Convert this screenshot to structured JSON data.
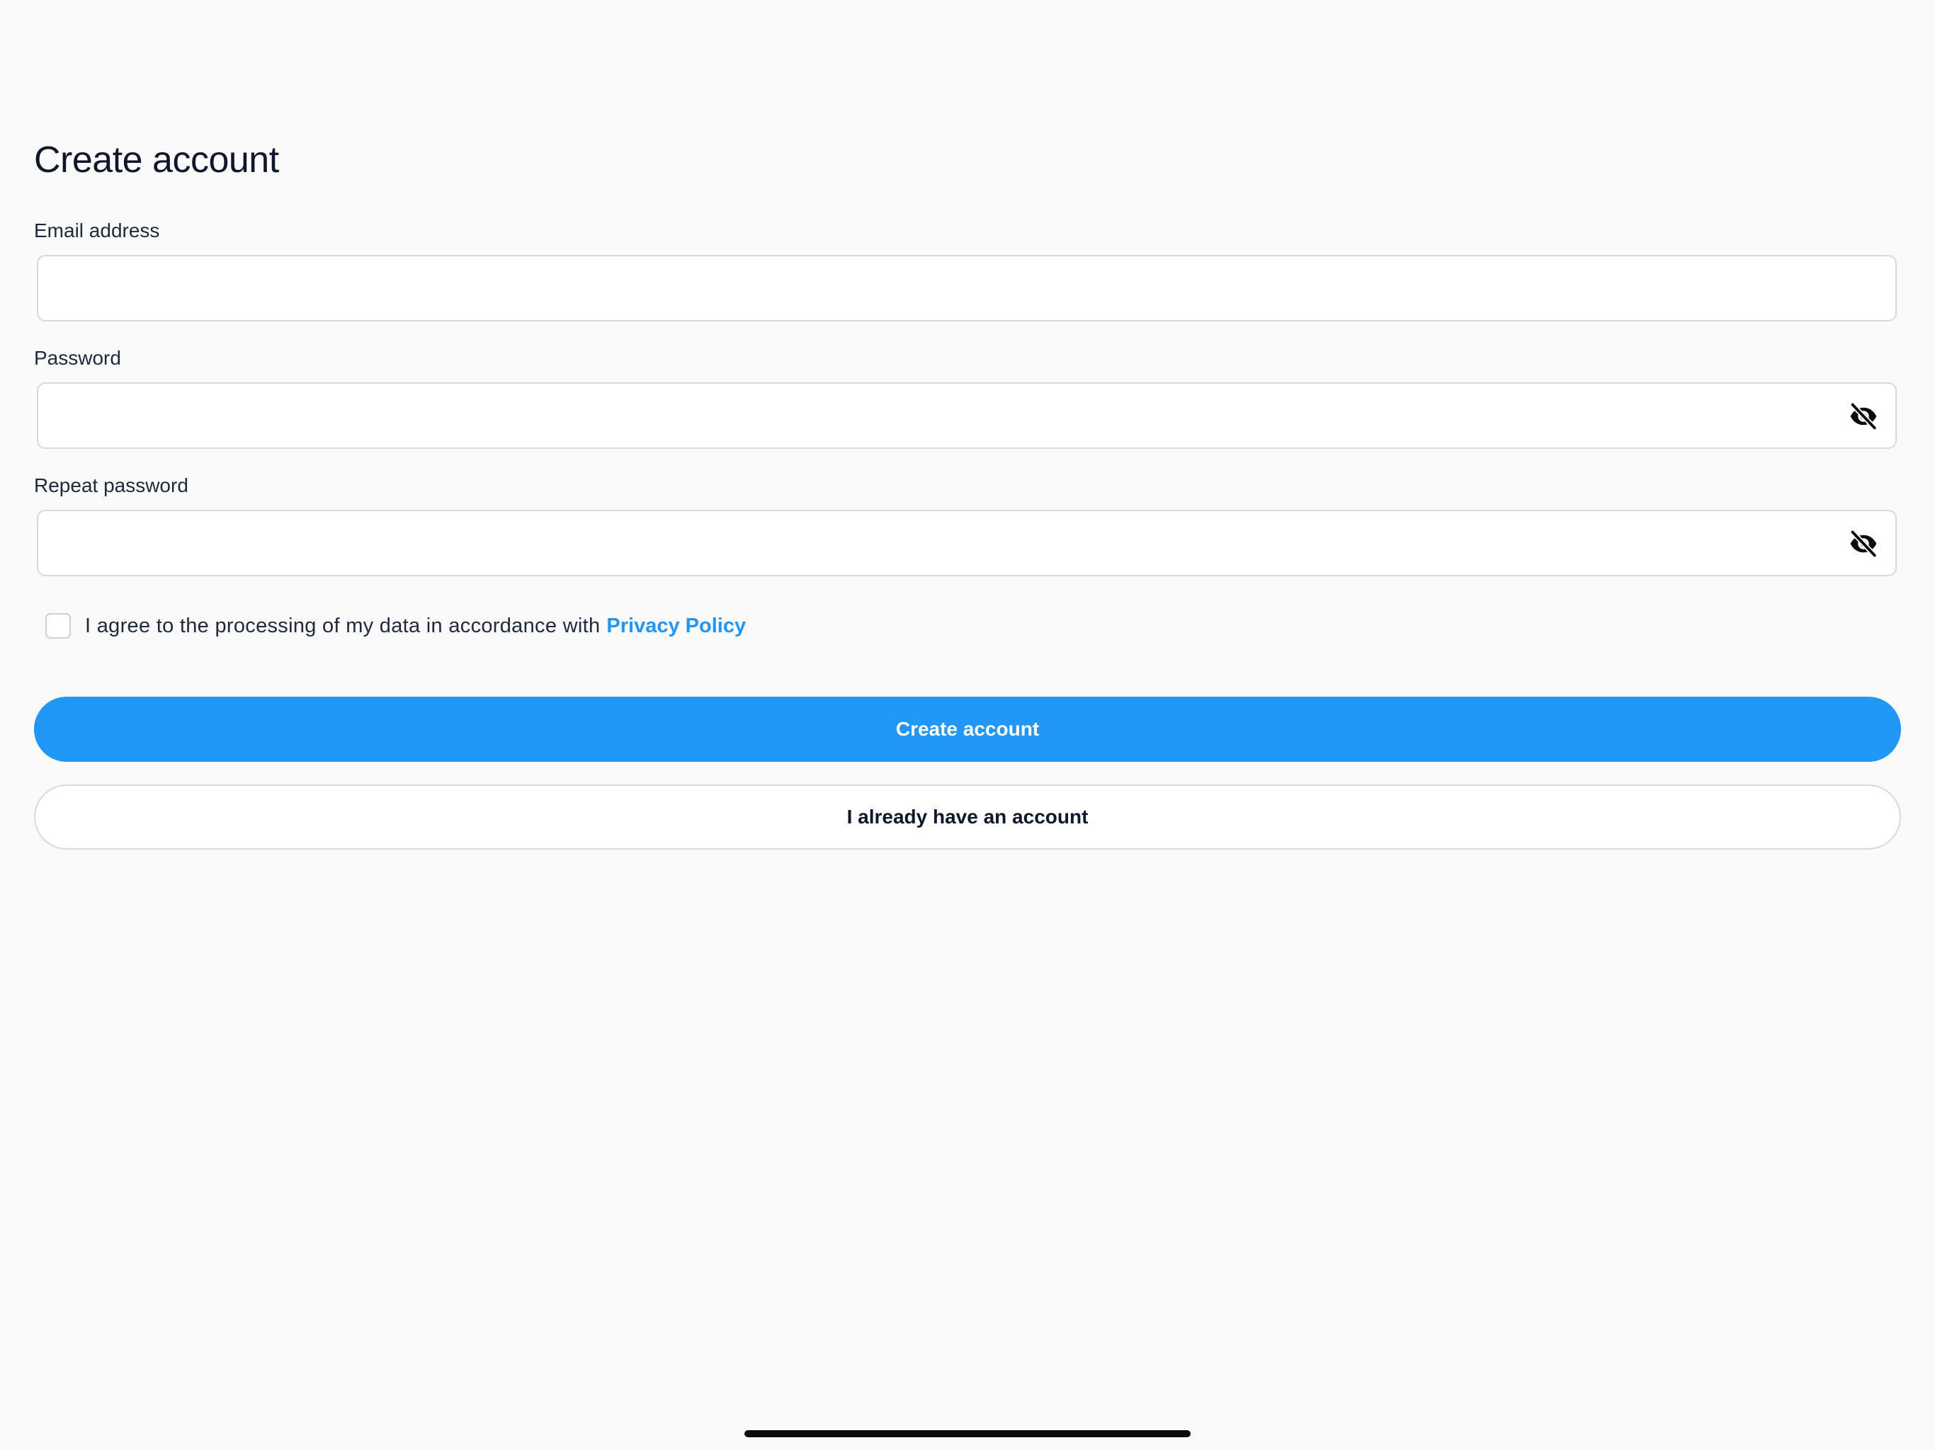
{
  "page": {
    "title": "Create account"
  },
  "form": {
    "email": {
      "label": "Email address",
      "value": "",
      "placeholder": ""
    },
    "password": {
      "label": "Password",
      "value": "",
      "placeholder": "",
      "toggle_icon": "eye-off-icon"
    },
    "repeat_password": {
      "label": "Repeat password",
      "value": "",
      "placeholder": "",
      "toggle_icon": "eye-off-icon"
    },
    "consent": {
      "checked": false,
      "text": "I agree to the processing of my data in accordance with",
      "link_label": "Privacy Policy"
    }
  },
  "actions": {
    "primary_label": "Create account",
    "secondary_label": "I already have an account"
  },
  "colors": {
    "accent": "#2196F3",
    "text": "#0F172A",
    "border": "#D6D9DE",
    "background": "#FAFAFA"
  }
}
